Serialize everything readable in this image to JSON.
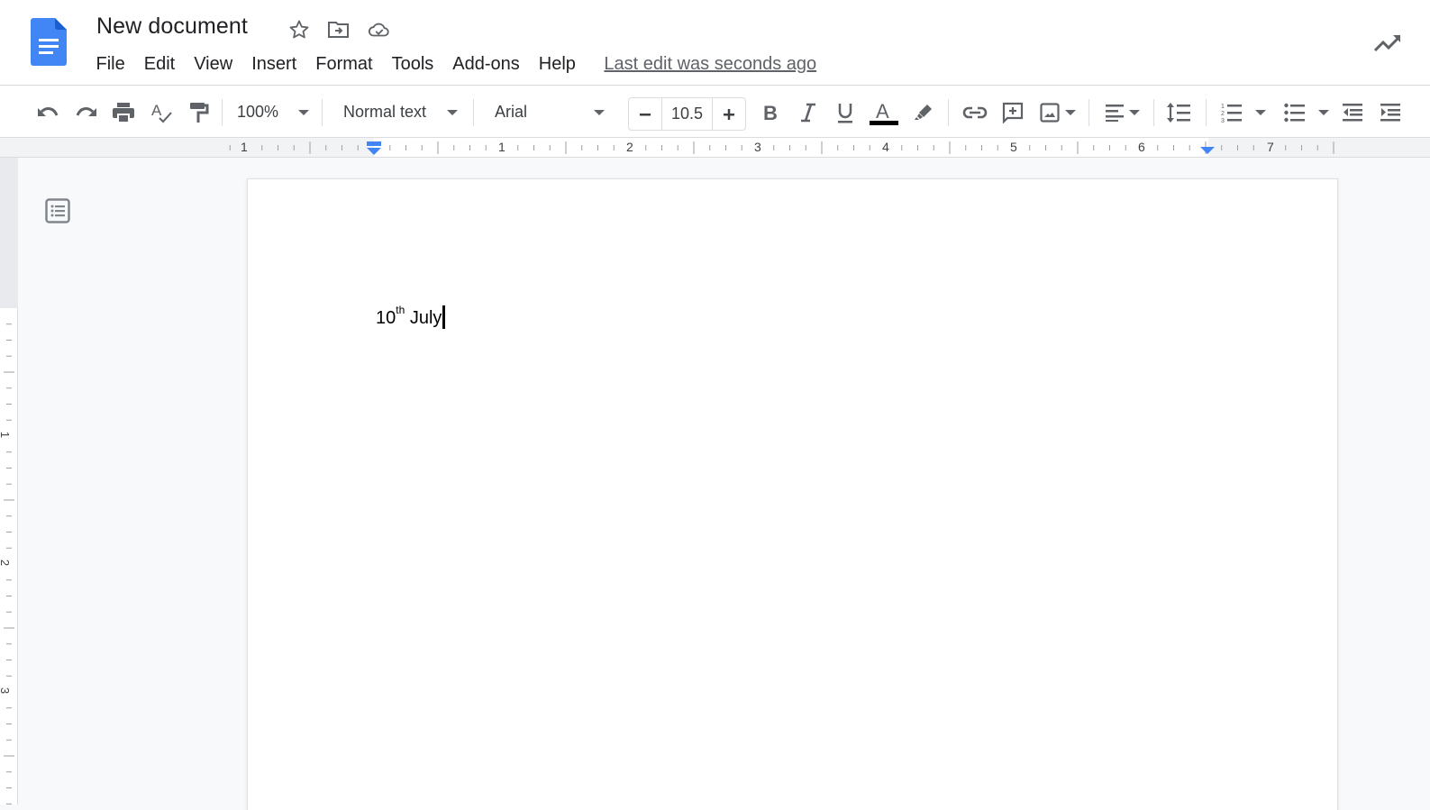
{
  "app": {
    "title": "New document",
    "last_edit": "Last edit was seconds ago",
    "brand_color": "#4285f4"
  },
  "menu": {
    "items": [
      "File",
      "Edit",
      "View",
      "Insert",
      "Format",
      "Tools",
      "Add-ons",
      "Help"
    ]
  },
  "toolbar": {
    "zoom": "100%",
    "style": "Normal text",
    "font": "Arial",
    "font_size": "10.5",
    "text_color": "#000000",
    "accent_color": "#4285f4"
  },
  "ruler": {
    "labels": [
      "1",
      "1",
      "2",
      "3",
      "4",
      "5",
      "6",
      "7"
    ],
    "vertical_labels": [
      "1",
      "2",
      "3"
    ]
  },
  "document": {
    "text_day": "10",
    "text_suffix": "th",
    "text_month": " July"
  }
}
